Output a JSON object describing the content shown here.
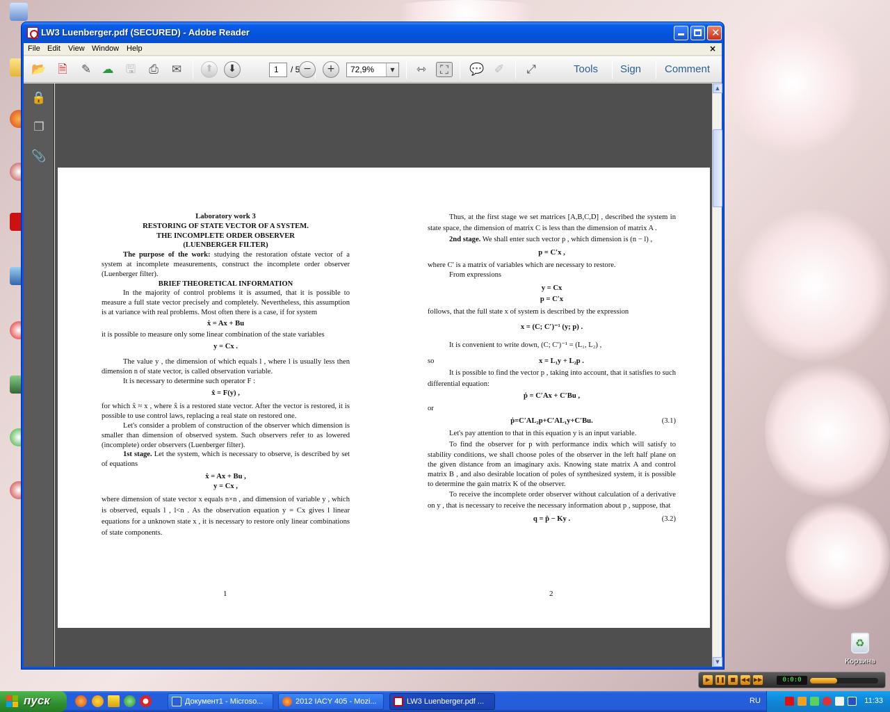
{
  "window": {
    "title": "LW3 Luenberger.pdf (SECURED) - Adobe Reader"
  },
  "menu": {
    "items": [
      "File",
      "Edit",
      "View",
      "Window",
      "Help"
    ],
    "close": "×"
  },
  "toolbar": {
    "page_current": "1",
    "page_total": "/ 5",
    "zoom": "72,9%",
    "links": [
      "Tools",
      "Sign",
      "Comment"
    ]
  },
  "document": {
    "page1": {
      "lab_title": "Laboratory work 3",
      "main_title": "RESTORING OF STATE VECTOR OF A SYSTEM.",
      "subtitle1": "THE INCOMPLETE ORDER OBSERVER",
      "subtitle2": "(LUENBERGER FILTER)",
      "purpose_label": "The purpose of the work:",
      "purpose_text": " studying the restoration ofstate vector of a system at incomplete measurements, construct the incomplete order observer (Luenberger filter).",
      "brief_heading": "BRIEF THEORETICAL INFORMATION",
      "p1": "In the majority of control problems it is assumed, that it is possible to measure a full state vector precisely and completely. Nevertheless, this assumption is at variance with real problems. Most often there is a case, if for system",
      "eq1": "ẋ = Ax + Bu",
      "p2": "it is possible to measure only some linear combination of the state variables",
      "eq2": "y = Cx .",
      "p3": "The value y , the dimension of which equals l , where l is usually less then dimension n of state vector, is called observation variable.",
      "p4": "It is necessary to determine such operator F :",
      "eq3": "x̂ = F(y) ,",
      "p5": "for which x̂ ≈ x , where x̂ is a restored state vector. After the vector is restored, it is possible to use control laws, replacing a real state on restored one.",
      "p6": "Let's consider a problem of construction of the observer which dimension is smaller than dimension of observed system. Such observers refer to as lowered (incomplete) order observers (Luenberger filter).",
      "stage1_label": "1st stage.",
      "stage1_text": " Let the system, which is necessary to observe, is described by set of equations",
      "eq4": "ẋ = Ax + Bu ,",
      "eq5": "y = Cx ,",
      "p7": "where dimension of state vector x equals n×n , and dimension of variable y , which is observed, equals l , l<n . As the observation equation y = Cx gives l linear equations for a unknown state x , it is necessary to restore only linear combinations of state components.",
      "page_number": "1"
    },
    "page2": {
      "p1": "Thus, at the first stage we set matrices [A,B,C,D] , described the system in state space, the dimension of matrix C is less than the dimension of matrix A .",
      "stage2_label": "2nd stage.",
      "stage2_text": " We shall enter such vector p , which dimension is (n − l) ,",
      "eq1": "p = C′x ,",
      "p2": "where C′ is a matrix of variables which are necessary to restore.",
      "p3": "From expressions",
      "eq2": "y = Cx",
      "eq3": "p = C′x",
      "p4": "follows, that the full state x of system is described by the expression",
      "eq4": "x = (C; C′)⁻¹ (y; p) .",
      "p5": "It is convenient to write down, (C; C′)⁻¹ = (L₁, L₂) ,",
      "p6_so": "so",
      "eq5": "x = L₁y + L₂p .",
      "p7": "It is possible to find the vector p , taking into account, that it satisfies to such differential equation:",
      "eq6": "ṗ = C′Ax + C′Bu ,",
      "p8_or": "or",
      "eq7": "ṗ=C′AL₂p+C′AL₁y+C′Bu.",
      "eq7_num": "(3.1)",
      "p9": "Let's pay attention to that in this equation y is an input variable.",
      "p10": "To find the observer for p with performance indix which will satisfy to stability conditions, we shall choose poles of the observer in the left half plane on the given distance from an imaginary axis. Knowing state matrix A and control matrix B , and also desirable location of poles of synthesized system, it is possible to determine the gain matrix K of the observer.",
      "p11": "To receive the incomplete order observer without calculation of a derivative on y , that is necessary to receive the necessary information about p , suppose, that",
      "eq8": "q = p̂ − Ky .",
      "eq8_num": "(3.2)",
      "page_number": "2"
    }
  },
  "desktop": {
    "recycle_bin": "Корзина"
  },
  "taskbar": {
    "start": "пуск",
    "tasks": [
      "Документ1 - Microso...",
      "2012 IACY 405 - Mozi...",
      "LW3 Luenberger.pdf ..."
    ],
    "language": "RU",
    "clock": "11:33"
  },
  "mini_player": {
    "time": "0:0:0"
  },
  "colors": {
    "title_bar": "#0453dc",
    "doc_background": "#4f4f4f",
    "nav_panel": "#5a5a5a",
    "taskbar": "#245edb",
    "start_button": "#2f8f2f"
  }
}
